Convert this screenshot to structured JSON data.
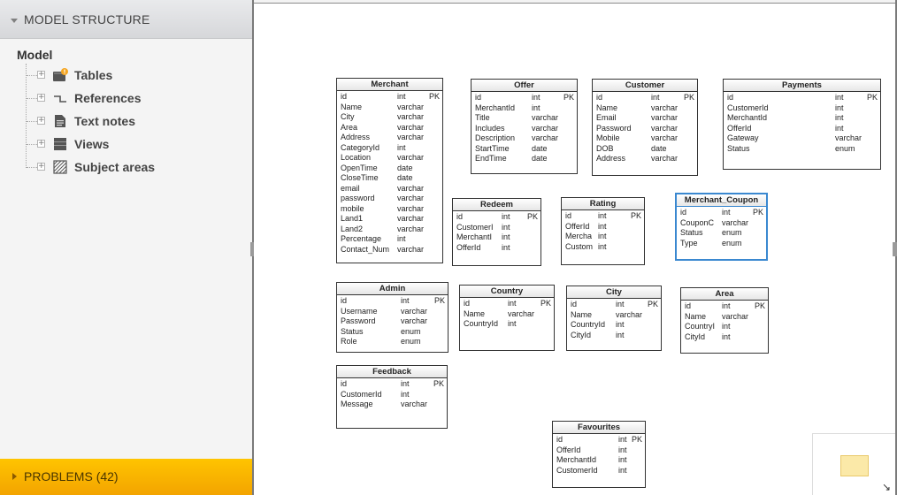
{
  "left_panel": {
    "header_title": "MODEL STRUCTURE",
    "tree": {
      "root_label": "Model",
      "items": [
        {
          "label": "Tables",
          "icon": "table-warning-icon"
        },
        {
          "label": "References",
          "icon": "reference-icon"
        },
        {
          "label": "Text notes",
          "icon": "note-icon"
        },
        {
          "label": "Views",
          "icon": "view-icon"
        },
        {
          "label": "Subject areas",
          "icon": "subject-area-icon"
        }
      ],
      "expander_symbol": "+"
    },
    "problems_label": "PROBLEMS (42)"
  },
  "colors": {
    "selected_table_border": "#3a88d0",
    "problems_bar": "#ffc400",
    "warning_badge": "#f5a623"
  },
  "tables": {
    "merchant": {
      "name": "Merchant",
      "columns": [
        {
          "name": "id",
          "type": "int",
          "key": "PK"
        },
        {
          "name": "Name",
          "type": "varchar",
          "key": ""
        },
        {
          "name": "City",
          "type": "varchar",
          "key": ""
        },
        {
          "name": "Area",
          "type": "varchar",
          "key": ""
        },
        {
          "name": "Address",
          "type": "varchar",
          "key": ""
        },
        {
          "name": "CategoryId",
          "type": "int",
          "key": ""
        },
        {
          "name": "Location",
          "type": "varchar",
          "key": ""
        },
        {
          "name": "OpenTime",
          "type": "date",
          "key": ""
        },
        {
          "name": "CloseTime",
          "type": "date",
          "key": ""
        },
        {
          "name": "email",
          "type": "varchar",
          "key": ""
        },
        {
          "name": "password",
          "type": "varchar",
          "key": ""
        },
        {
          "name": "mobile",
          "type": "varchar",
          "key": ""
        },
        {
          "name": "Land1",
          "type": "varchar",
          "key": ""
        },
        {
          "name": "Land2",
          "type": "varchar",
          "key": ""
        },
        {
          "name": "Percentage",
          "type": "int",
          "key": ""
        },
        {
          "name": "Contact_Num",
          "type": "varchar",
          "key": ""
        }
      ]
    },
    "offer": {
      "name": "Offer",
      "columns": [
        {
          "name": "id",
          "type": "int",
          "key": "PK"
        },
        {
          "name": "MerchantId",
          "type": "int",
          "key": ""
        },
        {
          "name": "Title",
          "type": "varchar",
          "key": ""
        },
        {
          "name": "Includes",
          "type": "varchar",
          "key": ""
        },
        {
          "name": "Description",
          "type": "varchar",
          "key": ""
        },
        {
          "name": "StartTime",
          "type": "date",
          "key": ""
        },
        {
          "name": "EndTime",
          "type": "date",
          "key": ""
        }
      ]
    },
    "customer": {
      "name": "Customer",
      "columns": [
        {
          "name": "id",
          "type": "int",
          "key": "PK"
        },
        {
          "name": "Name",
          "type": "varchar",
          "key": ""
        },
        {
          "name": "Email",
          "type": "varchar",
          "key": ""
        },
        {
          "name": "Password",
          "type": "varchar",
          "key": ""
        },
        {
          "name": "Mobile",
          "type": "varchar",
          "key": ""
        },
        {
          "name": "DOB",
          "type": "date",
          "key": ""
        },
        {
          "name": "Address",
          "type": "varchar",
          "key": ""
        }
      ]
    },
    "payments": {
      "name": "Payments",
      "columns": [
        {
          "name": "id",
          "type": "int",
          "key": "PK"
        },
        {
          "name": "CustomerId",
          "type": "int",
          "key": ""
        },
        {
          "name": "MerchantId",
          "type": "int",
          "key": ""
        },
        {
          "name": "OfferId",
          "type": "int",
          "key": ""
        },
        {
          "name": "Gateway",
          "type": "varchar",
          "key": ""
        },
        {
          "name": "Status",
          "type": "enum",
          "key": ""
        }
      ]
    },
    "redeem": {
      "name": "Redeem",
      "columns": [
        {
          "name": "id",
          "type": "int",
          "key": "PK"
        },
        {
          "name": "CustomerI",
          "type": "int",
          "key": ""
        },
        {
          "name": "MerchantI",
          "type": "int",
          "key": ""
        },
        {
          "name": "OfferId",
          "type": "int",
          "key": ""
        }
      ]
    },
    "rating": {
      "name": "Rating",
      "columns": [
        {
          "name": "id",
          "type": "int",
          "key": "PK"
        },
        {
          "name": "OfferId",
          "type": "int",
          "key": ""
        },
        {
          "name": "Mercha",
          "type": "int",
          "key": ""
        },
        {
          "name": "Custom",
          "type": "int",
          "key": ""
        }
      ]
    },
    "merchant_coupon": {
      "name": "Merchant_Coupon",
      "columns": [
        {
          "name": "id",
          "type": "int",
          "key": "PK"
        },
        {
          "name": "CouponC",
          "type": "varchar",
          "key": ""
        },
        {
          "name": "Status",
          "type": "enum",
          "key": ""
        },
        {
          "name": "Type",
          "type": "enum",
          "key": ""
        }
      ]
    },
    "admin": {
      "name": "Admin",
      "columns": [
        {
          "name": "id",
          "type": "int",
          "key": "PK"
        },
        {
          "name": "Username",
          "type": "varchar",
          "key": ""
        },
        {
          "name": "Password",
          "type": "varchar",
          "key": ""
        },
        {
          "name": "Status",
          "type": "enum",
          "key": ""
        },
        {
          "name": "Role",
          "type": "enum",
          "key": ""
        }
      ]
    },
    "country": {
      "name": "Country",
      "columns": [
        {
          "name": "id",
          "type": "int",
          "key": "PK"
        },
        {
          "name": "Name",
          "type": "varchar",
          "key": ""
        },
        {
          "name": "CountryId",
          "type": "int",
          "key": ""
        }
      ]
    },
    "city": {
      "name": "City",
      "columns": [
        {
          "name": "id",
          "type": "int",
          "key": "PK"
        },
        {
          "name": "Name",
          "type": "varchar",
          "key": ""
        },
        {
          "name": "CountryId",
          "type": "int",
          "key": ""
        },
        {
          "name": "CityId",
          "type": "int",
          "key": ""
        }
      ]
    },
    "area": {
      "name": "Area",
      "columns": [
        {
          "name": "id",
          "type": "int",
          "key": "PK"
        },
        {
          "name": "Name",
          "type": "varchar",
          "key": ""
        },
        {
          "name": "CountryI",
          "type": "int",
          "key": ""
        },
        {
          "name": "CityId",
          "type": "int",
          "key": ""
        }
      ]
    },
    "feedback": {
      "name": "Feedback",
      "columns": [
        {
          "name": "id",
          "type": "int",
          "key": "PK"
        },
        {
          "name": "CustomerId",
          "type": "int",
          "key": ""
        },
        {
          "name": "Message",
          "type": "varchar",
          "key": ""
        }
      ]
    },
    "favourites": {
      "name": "Favourites",
      "columns": [
        {
          "name": "id",
          "type": "int",
          "key": "PK"
        },
        {
          "name": "OfferId",
          "type": "int",
          "key": ""
        },
        {
          "name": "MerchantId",
          "type": "int",
          "key": ""
        },
        {
          "name": "CustomerId",
          "type": "int",
          "key": ""
        }
      ]
    }
  }
}
